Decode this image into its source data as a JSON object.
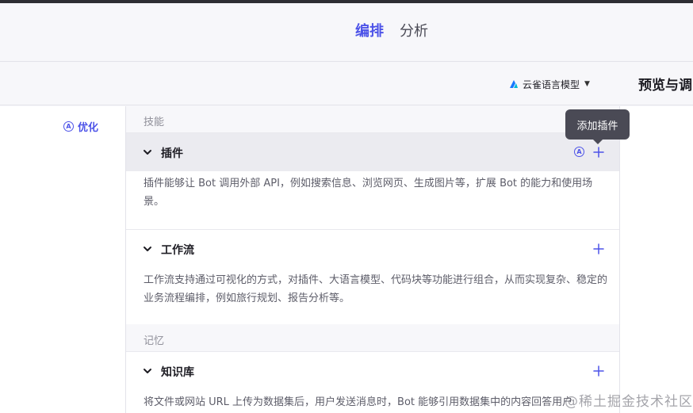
{
  "tabs": {
    "arrange": "编排",
    "analyze": "分析"
  },
  "toolbar": {
    "model_name": "云雀语言模型",
    "preview_title": "预览与调"
  },
  "left": {
    "optimize_label": "优化",
    "auto_badge": "A"
  },
  "skills": {
    "section_label": "技能",
    "plugin": {
      "title": "插件",
      "auto_badge": "A",
      "description": "插件能够让 Bot 调用外部 API，例如搜索信息、浏览网页、生成图片等，扩展 Bot 的能力和使用场景。"
    },
    "workflow": {
      "title": "工作流",
      "description": "工作流支持通过可视化的方式，对插件、大语言模型、代码块等功能进行组合，从而实现复杂、稳定的业务流程编排，例如旅行规划、报告分析等。"
    }
  },
  "memory": {
    "section_label": "记忆",
    "knowledge": {
      "title": "知识库",
      "description": "将文件或网站 URL 上传为数据集后，用户发送消息时，Bot 能够引用数据集中的内容回答用户"
    }
  },
  "tooltip": {
    "text": "添加插件"
  },
  "watermark": {
    "text": "@稀土掘金技术社区"
  },
  "colors": {
    "accent": "#4d53e8",
    "text": "#1d1c23",
    "muted": "#8f8f99"
  }
}
